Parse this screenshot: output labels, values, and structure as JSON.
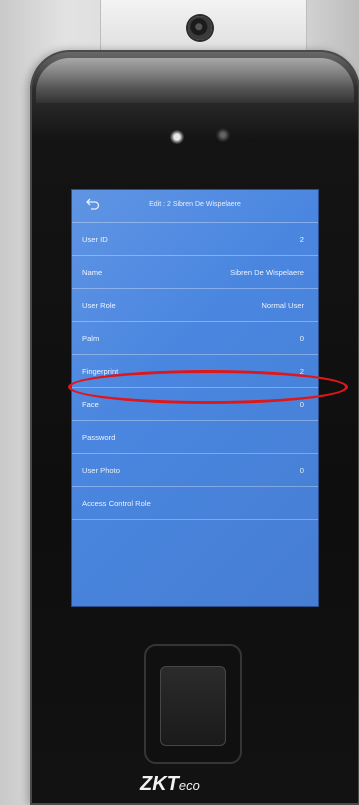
{
  "screen": {
    "title": "Edit : 2 Sibren De Wispelaere",
    "rows": [
      {
        "label": "User ID",
        "value": "2"
      },
      {
        "label": "Name",
        "value": "Sibren De Wispelaere"
      },
      {
        "label": "User Role",
        "value": "Normal User"
      },
      {
        "label": "Palm",
        "value": "0"
      },
      {
        "label": "Fingerprint",
        "value": "2"
      },
      {
        "label": "Face",
        "value": "0"
      },
      {
        "label": "Password",
        "value": ""
      },
      {
        "label": "User Photo",
        "value": "0"
      },
      {
        "label": "Access Control Role",
        "value": ""
      }
    ]
  },
  "brand": {
    "logo_main": "ZKT",
    "logo_suffix": "eco"
  },
  "colors": {
    "screen_bg": "#4a86e0",
    "highlight": "#e0161a",
    "device_body": "#111111"
  },
  "icons": {
    "back": "back-arrow-icon"
  }
}
